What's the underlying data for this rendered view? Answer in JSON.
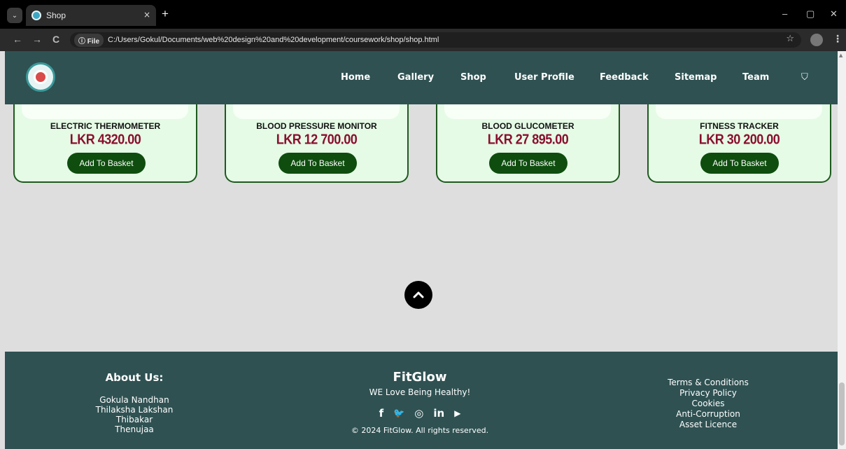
{
  "browser": {
    "tab_title": "Shop",
    "tab_close": "×",
    "new_tab": "+",
    "file_label": "File",
    "url": "C:/Users/Gokul/Documents/web%20design%20and%20development/coursework/shop/shop.html",
    "minimize": "–",
    "restore": "▢",
    "close": "✕",
    "back": "←",
    "forward": "→",
    "reload": "C",
    "bookmark": "☆",
    "menu": "⋮",
    "tab_menu": "⌄"
  },
  "nav": {
    "items": [
      "Home",
      "Gallery",
      "Shop",
      "User Profile",
      "Feedback",
      "Sitemap",
      "Team"
    ],
    "basket_icon": "⛉"
  },
  "products": [
    {
      "name": "ELECTRIC THERMOMETER",
      "price": "LKR 4320.00",
      "button": "Add To Basket"
    },
    {
      "name": "BLOOD PRESSURE MONITOR",
      "price": "LKR 12 700.00",
      "button": "Add To Basket"
    },
    {
      "name": "BLOOD GLUCOMETER",
      "price": "LKR 27 895.00",
      "button": "Add To Basket"
    },
    {
      "name": "FITNESS TRACKER",
      "price": "LKR 30 200.00",
      "button": "Add To Basket"
    }
  ],
  "footer": {
    "about_title": "About Us:",
    "team": [
      "Gokula Nandhan",
      "Thilaksha Lakshan",
      "Thibakar",
      "Thenujaa"
    ],
    "brand": "FitGlow",
    "tagline": "WE Love Being Healthy!",
    "socials": [
      "f",
      "🐦",
      "◎",
      "in",
      "▶"
    ],
    "copyright": "© 2024 FitGlow. All rights reserved.",
    "links": [
      "Terms & Conditions",
      "Privacy Policy",
      "Cookies",
      "Anti-Corruption",
      "Asset Licence"
    ]
  },
  "colors": {
    "header_bg": "#2f5152",
    "card_bg": "#e5fbe6",
    "button_bg": "#0e4d0e",
    "price": "#8a0f2e"
  }
}
